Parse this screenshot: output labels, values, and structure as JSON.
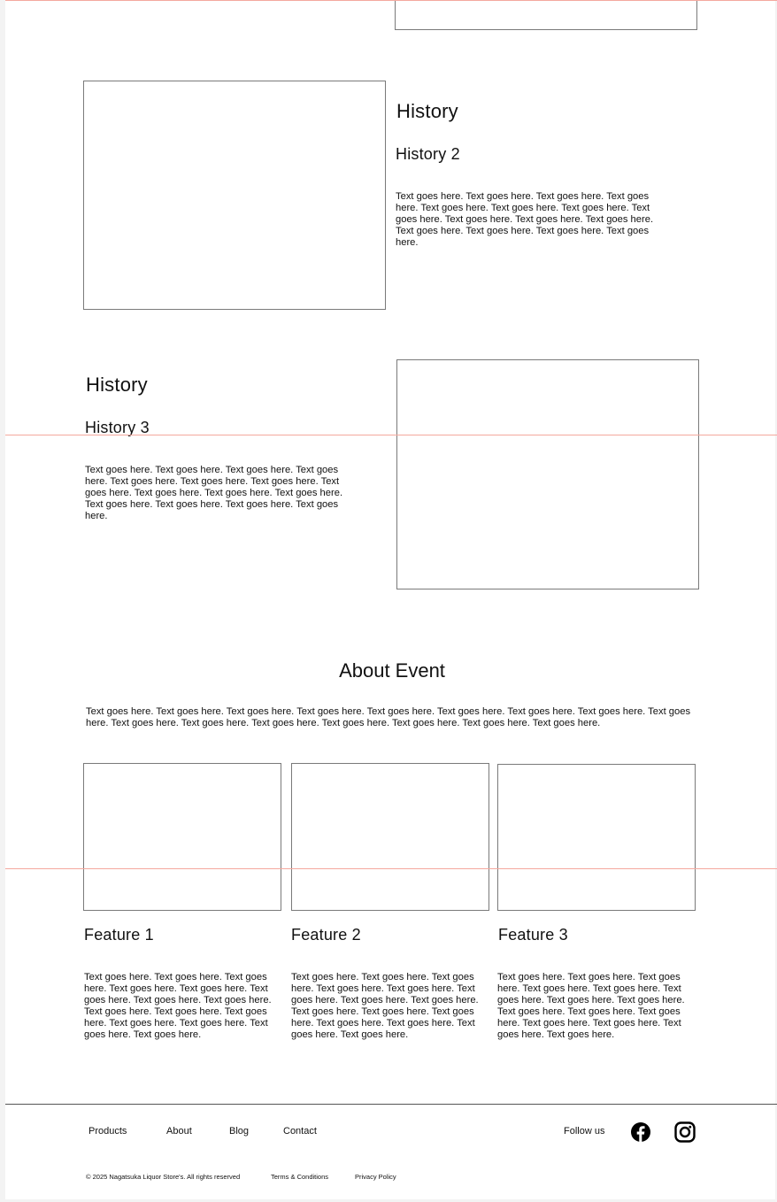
{
  "history_2": {
    "heading": "History",
    "subheading": "History 2",
    "body": "Text goes here. Text goes here. Text goes here. Text goes here. Text goes here. Text goes here. Text goes here. Text goes here. Text goes here. Text goes here. Text goes here. Text goes here. Text goes here. Text goes here. Text goes here."
  },
  "history_3": {
    "heading": "History",
    "subheading": "History 3",
    "body": "Text goes here. Text goes here. Text goes here. Text goes here. Text goes here. Text goes here. Text goes here. Text goes here. Text goes here. Text goes here. Text goes here. Text goes here. Text goes here. Text goes here. Text goes here."
  },
  "about_event": {
    "heading": "About Event",
    "body": "Text goes here. Text goes here. Text goes here. Text goes here. Text goes here. Text goes here. Text goes here. Text goes here. Text goes here. Text goes here. Text goes here. Text goes here. Text goes here. Text goes here. Text goes here. Text goes here."
  },
  "features": [
    {
      "title": "Feature 1",
      "body": "Text goes here. Text goes here. Text goes here. Text goes here. Text goes here. Text goes here. Text goes here. Text goes here. Text goes here. Text goes here. Text goes here. Text goes here. Text goes here. Text goes here. Text goes here."
    },
    {
      "title": "Feature 2",
      "body": "Text goes here. Text goes here. Text goes here. Text goes here. Text goes here. Text goes here. Text goes here. Text goes here. Text goes here. Text goes here. Text goes here. Text goes here. Text goes here. Text goes here. Text goes here."
    },
    {
      "title": "Feature 3",
      "body": "Text goes here. Text goes here. Text goes here. Text goes here. Text goes here. Text goes here. Text goes here. Text goes here. Text goes here. Text goes here. Text goes here. Text goes here. Text goes here. Text goes here. Text goes here."
    }
  ],
  "footer": {
    "nav": [
      "Products",
      "About",
      "Blog",
      "Contact"
    ],
    "follow_label": "Follow us",
    "social_icons": [
      "facebook-icon",
      "instagram-icon"
    ],
    "copyright": "© 2025 Nagatsuka Liquor Store's. All rights reserved",
    "terms": "Terms & Conditions",
    "privacy": "Privacy Policy"
  },
  "colors": {
    "guide_line": "#f4a89e",
    "placeholder_border": "#7a7a7a",
    "background": "#ffffff"
  }
}
